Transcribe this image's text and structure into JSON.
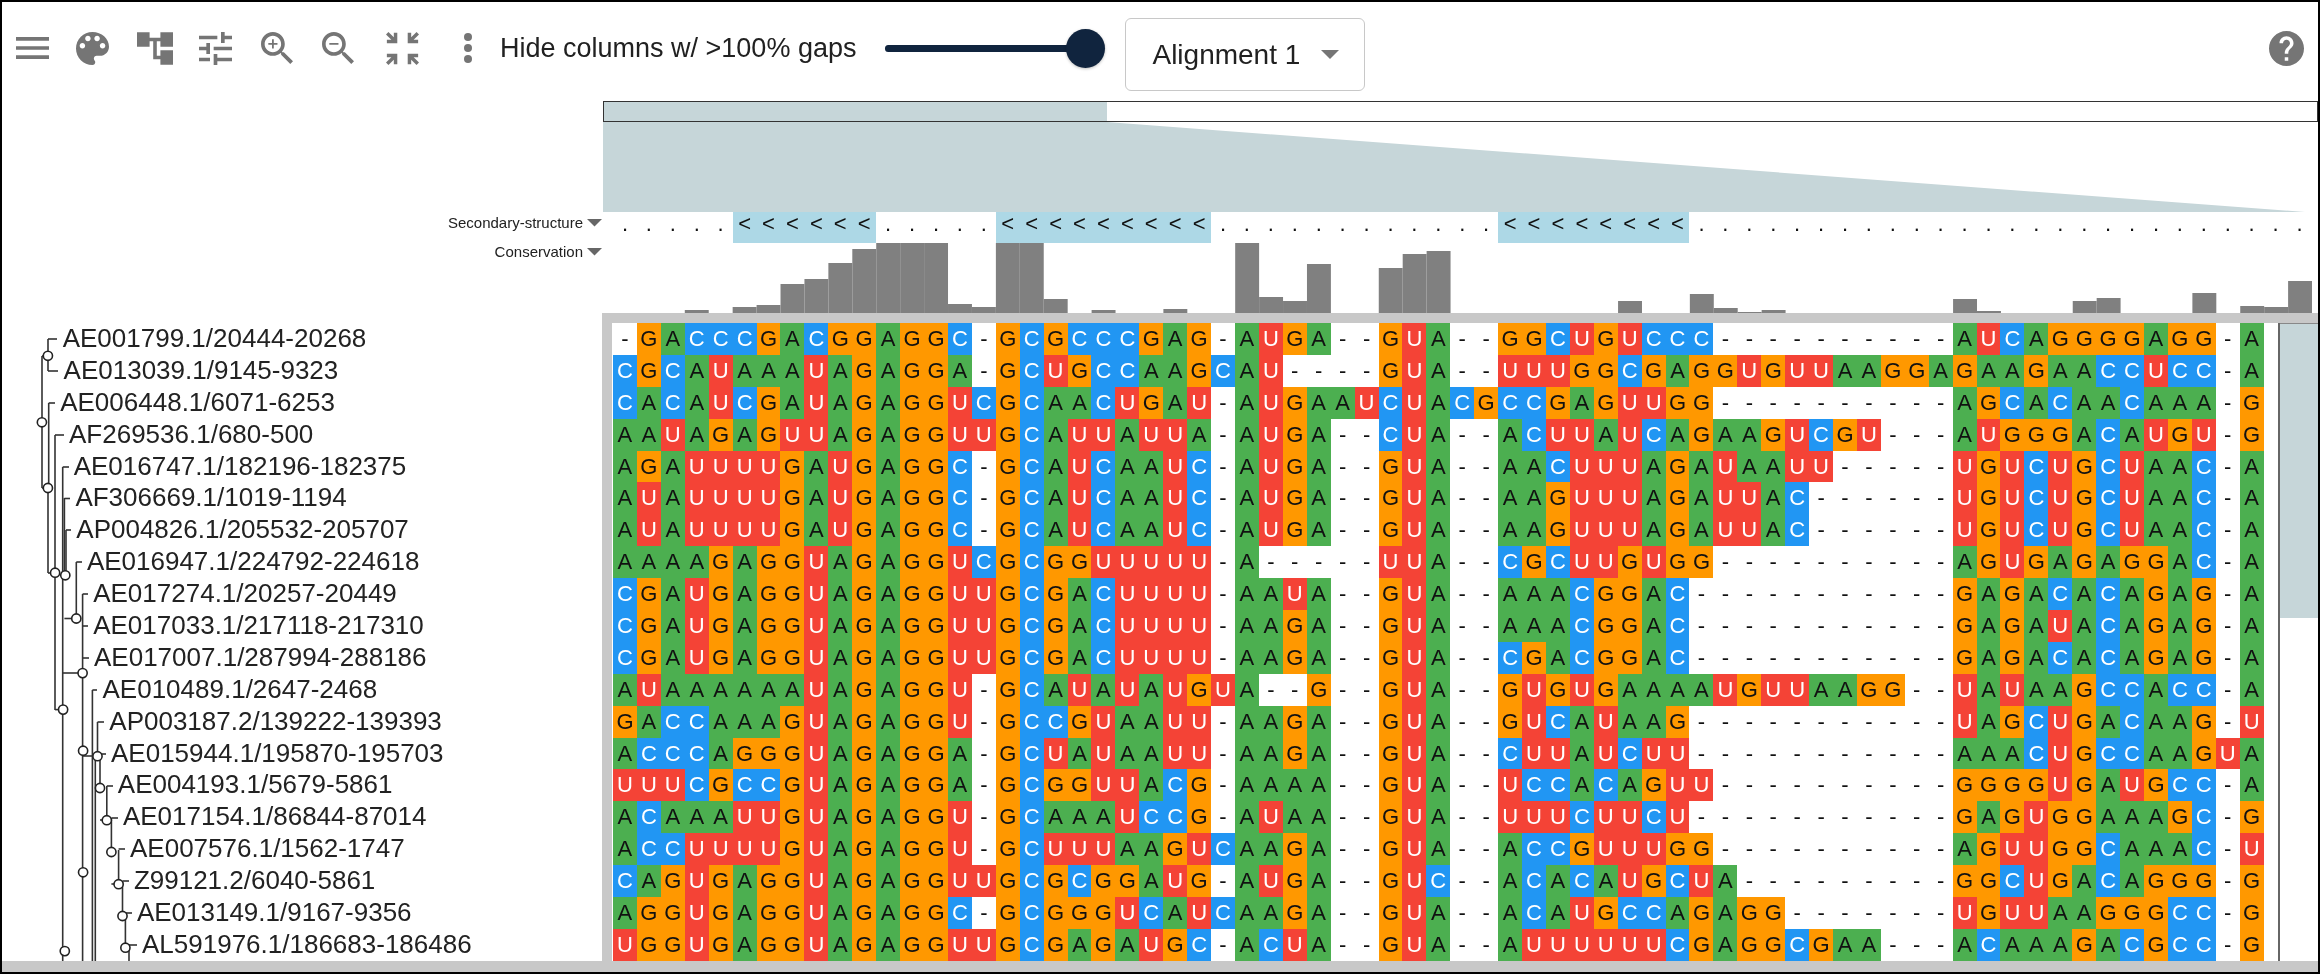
{
  "toolbar": {
    "gap_filter": {
      "label": "Hide columns w/ >100% gaps",
      "level": 1
    },
    "alignment_select": {
      "value": "Alignment 1"
    }
  },
  "tracks": [
    {
      "kind": "structure",
      "label": "Secondary-structure",
      "segments": [
        {
          "text": ". . . . .",
          "paired": false
        },
        {
          "text": "< < < < < <",
          "paired": true
        },
        {
          "text": ". . . . .",
          "paired": false
        },
        {
          "text": "< < < < < < < < <",
          "paired": true
        },
        {
          "text": ". . . . . . . . . . . .",
          "paired": false
        },
        {
          "text": "< < < < < < < <",
          "paired": true
        },
        {
          "text": ". . . . . . . . . . . . . . . . . . . . . . . . . .",
          "paired": false
        }
      ]
    },
    {
      "kind": "conservation",
      "label": "Conservation"
    }
  ],
  "residue_colors": {
    "A": {
      "color": "#4caf50"
    },
    "C": {
      "color": "#2196f3"
    },
    "G": {
      "color": "#ff9800"
    },
    "U": {
      "color": "#f44336"
    }
  },
  "sequences": [
    {
      "name": "AE001799.1/20444-20268",
      "residues": "- G A C C C G A C G G A G G C - G C G C C C G A G - A U G A - - G U A - - G G C U G U C C C - - - - - - - - - - A U C A G G G G A G G - A"
    },
    {
      "name": "AE013039.1/9145-9323",
      "residues": "C G C A U A A A U A G A G G A - G C U G C C A A G C A U - - - - G U A - - U U U G G C G A G G U G U U A A G G A G A A G A A C C U C C - A"
    },
    {
      "name": "AE006448.1/6071-6253",
      "residues": "C A C A U C G A U A G A G G U C G C A A C U G A U - A U G A A U C U A C G C C G A G U U G G - - - - - - - - - - A G C A C A A C A A A - G"
    },
    {
      "name": "AF269536.1/680-500",
      "residues": "A A U A G A G U U A G A G G U U G C A U U A U U A - A U G A - - C U A - - A C U U A U C A G A A G U C G U - - - A U G G G A C A U G U - G"
    },
    {
      "name": "AE016747.1/182196-182375",
      "residues": "A G A U U U U G A U G A G G C - G C A U C A A U C - A U G A - - G U A - - A A C U U U A G A U A A U U - - - - - U G U C U G C U A A C - A"
    },
    {
      "name": "AF306669.1/1019-1194",
      "residues": "A U A U U U U G A U G A G G C - G C A U C A A U C - A U G A - - G U A - - A A G U U U A G A U U A C - - - - - - U G U C U G C U A A C - A"
    },
    {
      "name": "AP004826.1/205532-205707",
      "residues": "A U A U U U U G A U G A G G C - G C A U C A A U C - A U G A - - G U A - - A A G U U U A G A U U A C - - - - - - U G U C U G C U A A C - A"
    },
    {
      "name": "AE016947.1/224792-224618",
      "residues": "A A A A G A G G U A G A G G U C G C G G U U U U U - A - - - - - U U A - - C G C U U G U G G - - - - - - - - - - A G U G A G A G G A C - A"
    },
    {
      "name": "AE017274.1/20257-20449",
      "residues": "C G A U G A G G U A G A G G U U G C G A C U U U U - A A U A - - G U A - - A A A C G G A C - - - - - - - - - - - G A G A C A C A G A G - A"
    },
    {
      "name": "AE017033.1/217118-217310",
      "residues": "C G A U G A G G U A G A G G U U G C G A C U U U U - A A G A - - G U A - - A A A C G G A C - - - - - - - - - - - G A G A U A C A G A G - A"
    },
    {
      "name": "AE017007.1/287994-288186",
      "residues": "C G A U G A G G U A G A G G U U G C G A C U U U U - A A G A - - G U A - - C G A C G G A C - - - - - - - - - - - G A G A C A C A G A G - A"
    },
    {
      "name": "AE010489.1/2647-2468",
      "residues": "A U A A A A A A U A G A G G U - G C A U A U A U G U A - - G - - G U A - - G U G U G A A A A U G U U A A G G - - U A U A A G C C A C C - A"
    },
    {
      "name": "AP003187.2/139222-139393",
      "residues": "G A C C A A A G U A G A G G U - G C C G U A A U U - A A G A - - G U A - - G U C A U A A G - - - - - - - - - - - U A G C U G A C A A G - U"
    },
    {
      "name": "AE015944.1/195870-195703",
      "residues": "A C C C A G G G U A G A G G A - G C U A U A A U U - A A G A - - G U A - - C U U A U C U U - - - - - - - - - - - A A A C U G C C A A G U A"
    },
    {
      "name": "AE004193.1/5679-5861",
      "residues": "U U U C G C C G U A G A G G A - G C G G U U A C G - A A A A - - G U A - - U C C A C A G U U - - - - - - - - - - G G G G U G A U G C C - A"
    },
    {
      "name": "AE017154.1/86844-87014",
      "residues": "A C A A A U U G U A G A G G U - G C A A A U C C G - A U A A - - G U A - - U U U C U U C U - - - - - - - - - - - G A G U G G A A A G C - G"
    },
    {
      "name": "AE007576.1/1562-1747",
      "residues": "A C C U U U U G U A G A G G U - G C U U U A A G U C A A G A - - G U A - - A C C G U U U G G - - - - - - - - - - A G U U G G C A A A C - U"
    },
    {
      "name": "Z99121.2/6040-5861",
      "residues": "C A G U G A G G U A G A G G U U G C G C G G A U G - A U G A - - G U C - - A C A C A U G C U A - - - - - - - - - G G C U G A C A G G G - G"
    },
    {
      "name": "AE013149.1/9167-9356",
      "residues": "A G G U G A G G U A G A G G C - G C G G G U C A U C A A G A - - G U A - - A C A U G C C A G A G G - - - - - - - U G U U A A G G G C C - G"
    },
    {
      "name": "AL591976.1/186683-186486",
      "residues": "U G G U G A G G U A G A G G U U G C G A G A U G C - A C U A - - G U A - - A U U U U U U C G A G G C G A A - - - A C A A A G A C G C C - G"
    }
  ]
}
